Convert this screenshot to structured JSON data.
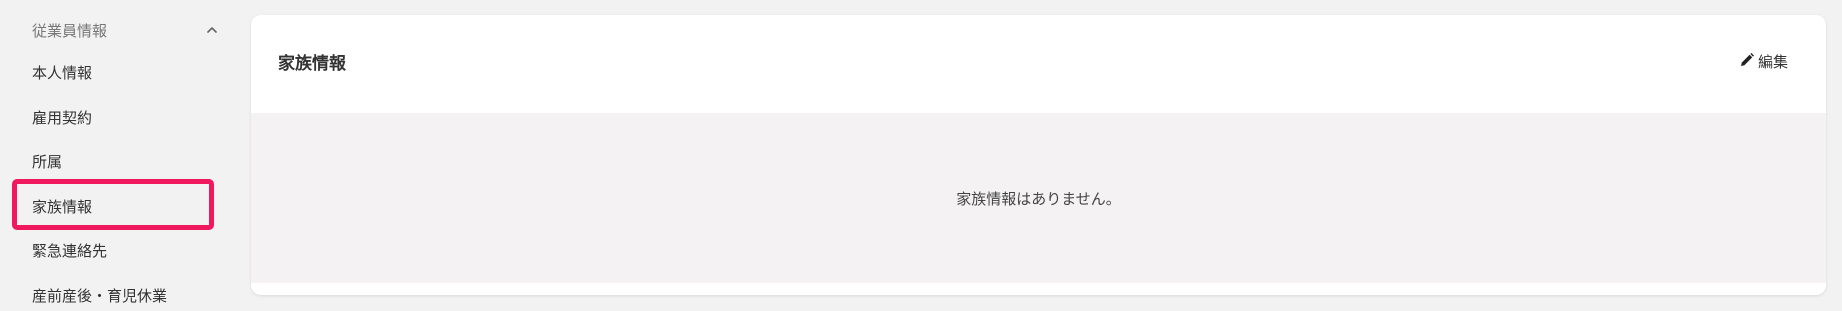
{
  "sidebar": {
    "section_title": "従業員情報",
    "items": [
      {
        "label": "本人情報"
      },
      {
        "label": "雇用契約"
      },
      {
        "label": "所属"
      },
      {
        "label": "家族情報"
      },
      {
        "label": "緊急連絡先"
      },
      {
        "label": "産前産後・育児休業"
      }
    ],
    "active_item": "家族情報",
    "icons": {
      "collapse": "chevron-up-icon"
    },
    "highlight_color": "#f0185e"
  },
  "card": {
    "title": "家族情報",
    "edit_label": "編集",
    "edit_icon": "pencil-icon",
    "empty_message": "家族情報はありません。"
  }
}
